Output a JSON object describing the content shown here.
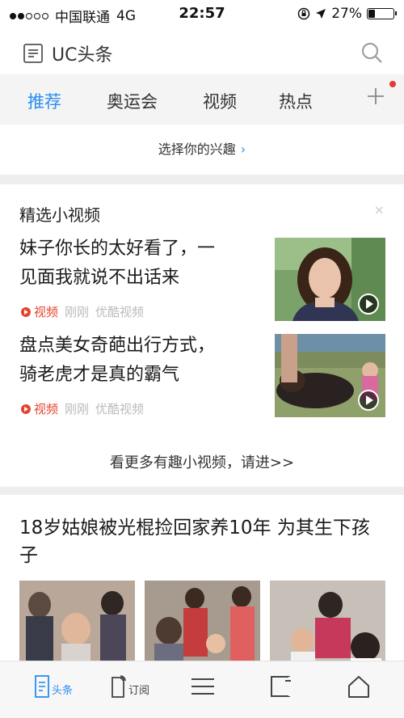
{
  "status_bar": {
    "carrier": "中国联通",
    "network": "4G",
    "time": "22:57",
    "battery": "27%",
    "battery_level": 0.27
  },
  "header": {
    "app_name": "UC头条",
    "icons": [
      "news-logo-icon",
      "search-icon"
    ]
  },
  "tabs": {
    "items": [
      {
        "label": "推荐",
        "active": true
      },
      {
        "label": "奥运会",
        "active": false
      },
      {
        "label": "视频",
        "active": false
      },
      {
        "label": "热点",
        "active": false
      }
    ],
    "add_icon": "plus-icon",
    "badge_color": "#e53935"
  },
  "interest": {
    "label": "选择你的兴趣",
    "chevron": "›"
  },
  "video_section": {
    "title": "精选小视频",
    "close": "×",
    "items": [
      {
        "title_line1": "妹子你长的太好看了，一",
        "title_line2": "见面我就说不出话来",
        "tag": "视频",
        "time": "刚刚",
        "source": "优酷视频"
      },
      {
        "title_line1": "盘点美女奇葩出行方式，",
        "title_line2": "骑老虎才是真的霸气",
        "tag": "视频",
        "time": "刚刚",
        "source": "优酷视频"
      }
    ],
    "more": "看更多有趣小视频，请进>>"
  },
  "news": {
    "title": "18岁姑娘被光棍捡回家养10年 为其生下孩子"
  },
  "bottom_bar": {
    "items": [
      {
        "label": "头条",
        "icon": "news-icon",
        "active": true
      },
      {
        "label": "订阅",
        "icon": "subscribe-icon",
        "active": false
      },
      {
        "label": "",
        "icon": "menu-icon",
        "active": false
      },
      {
        "label": "",
        "icon": "windows-icon",
        "active": false
      },
      {
        "label": "",
        "icon": "home-icon",
        "active": false
      }
    ]
  },
  "colors": {
    "accent": "#2a8ef0",
    "tag_red": "#e5442e",
    "background": "#eeeeee"
  }
}
